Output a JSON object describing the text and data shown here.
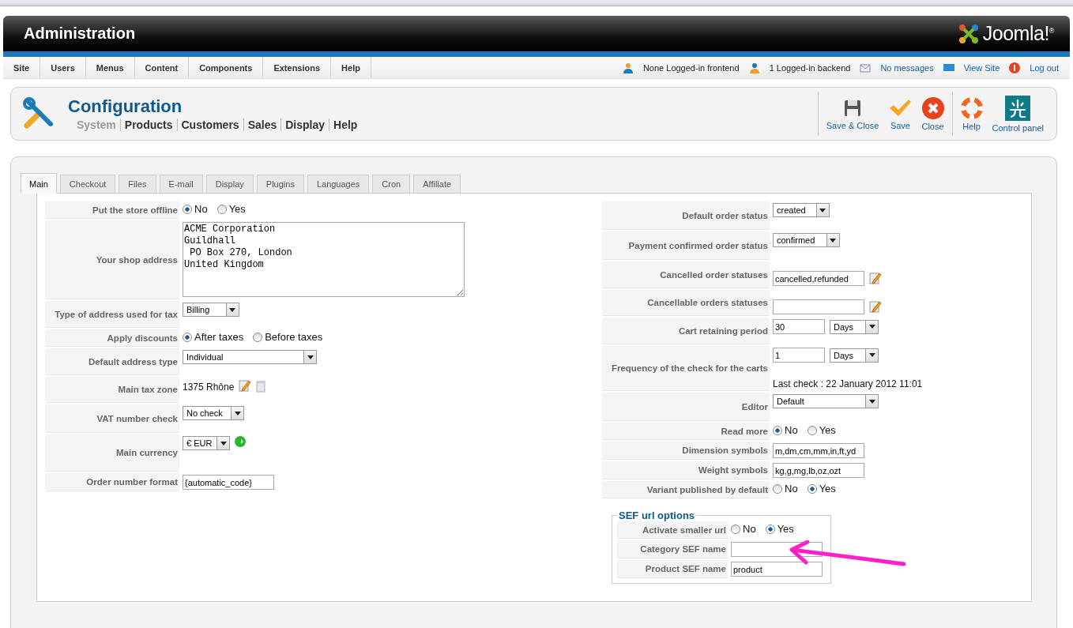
{
  "header": {
    "title": "Administration",
    "logo_text": "Joomla!$^{®}$"
  },
  "menu": [
    "Site",
    "Users",
    "Menus",
    "Content",
    "Components",
    "Extensions",
    "Help"
  ],
  "status": [
    {
      "label": "None Logged-in frontend",
      "kind": "frontend"
    },
    {
      "label": "1 Logged-in backend",
      "kind": "backend"
    },
    {
      "label": "No messages",
      "kind": "messages"
    },
    {
      "label": "View Site",
      "kind": "site"
    },
    {
      "label": "Log out",
      "kind": "logout"
    }
  ],
  "page": {
    "title": "Configuration",
    "subnav": [
      {
        "label": "System",
        "selected": true
      },
      {
        "label": "Products",
        "selected": false
      },
      {
        "label": "Customers",
        "selected": false
      },
      {
        "label": "Sales",
        "selected": false
      },
      {
        "label": "Display",
        "selected": false
      },
      {
        "label": "Help",
        "selected": false
      }
    ]
  },
  "toolbar": [
    {
      "label": "Save & Close",
      "kind": "save-close"
    },
    {
      "label": "Save",
      "kind": "save"
    },
    {
      "label": "Close",
      "kind": "close"
    },
    {
      "label": "Help",
      "kind": "help"
    },
    {
      "label": "Control panel",
      "kind": "cpanel"
    }
  ],
  "tabs": [
    {
      "label": "Main",
      "selected": true
    },
    {
      "label": "Checkout",
      "selected": false
    },
    {
      "label": "Files",
      "selected": false
    },
    {
      "label": "E-mail",
      "selected": false
    },
    {
      "label": "Display",
      "selected": false
    },
    {
      "label": "Plugins",
      "selected": false
    },
    {
      "label": "Languages",
      "selected": false
    },
    {
      "label": "Cron",
      "selected": false
    },
    {
      "label": "Affiliate",
      "selected": false
    }
  ],
  "left_fields": [
    {
      "label": "Put the store offline",
      "kind": "radio",
      "options": [
        {
          "label": "No",
          "selected": true
        },
        {
          "label": "Yes",
          "selected": false
        }
      ]
    },
    {
      "label": "Your shop address",
      "kind": "textarea",
      "value": "ACME Corporation\nGuildhall\n PO Box 270, London\nUnited Kingdom"
    },
    {
      "label": "Type of address used for tax",
      "kind": "select",
      "value": "Billing"
    },
    {
      "label": "Apply discounts",
      "kind": "radio",
      "options": [
        {
          "label": "After taxes",
          "selected": true
        },
        {
          "label": "Before taxes",
          "selected": false
        }
      ]
    },
    {
      "label": "Default address type",
      "kind": "select-wide",
      "value": "Individual"
    },
    {
      "label": "Main tax zone",
      "kind": "zone",
      "value": "1375 Rhône"
    },
    {
      "label": "VAT number check",
      "kind": "select",
      "value": "No check"
    },
    {
      "label": "Main currency",
      "kind": "currency",
      "value": "€ EUR"
    },
    {
      "label": "Order number format",
      "kind": "text",
      "value": "{automatic_code}"
    }
  ],
  "right_fields": [
    {
      "label": "Default order status",
      "kind": "select",
      "value": "created"
    },
    {
      "label": "Payment confirmed order status",
      "kind": "select",
      "value": "confirmed"
    },
    {
      "label": "Cancelled order statuses",
      "kind": "text-edit",
      "value": "cancelled,refunded"
    },
    {
      "label": "Cancellable orders statuses",
      "kind": "text-edit"
    },
    {
      "label": "Cart retaining period",
      "kind": "period",
      "value": "30",
      "unit": "Days"
    },
    {
      "label": "Frequency of the check for the carts",
      "kind": "period",
      "value": "1",
      "unit": "Days",
      "note": "Last check : 22 January 2012 11:01"
    },
    {
      "label": "Editor",
      "kind": "select-wide",
      "value": "Default"
    },
    {
      "label": "Read more",
      "kind": "radio",
      "options": [
        {
          "label": "No",
          "selected": true
        },
        {
          "label": "Yes",
          "selected": false
        }
      ]
    },
    {
      "label": "Dimension symbols",
      "kind": "text",
      "value": "m,dm,cm,mm,in,ft,yd"
    },
    {
      "label": "Weight symbols",
      "kind": "text",
      "value": "kg,g,mg,lb,oz,ozt"
    },
    {
      "label": "Variant published by default",
      "kind": "radio",
      "options": [
        {
          "label": "No",
          "selected": false
        },
        {
          "label": "Yes",
          "selected": true
        }
      ]
    }
  ],
  "sef": {
    "legend": "SEF url options",
    "fields": [
      {
        "label": "Activate smaller url",
        "kind": "radio",
        "options": [
          {
            "label": "No",
            "selected": false
          },
          {
            "label": "Yes",
            "selected": true
          }
        ]
      },
      {
        "label": "Category SEF name",
        "kind": "text"
      },
      {
        "label": "Product SEF name",
        "kind": "text",
        "value": "product"
      }
    ]
  }
}
